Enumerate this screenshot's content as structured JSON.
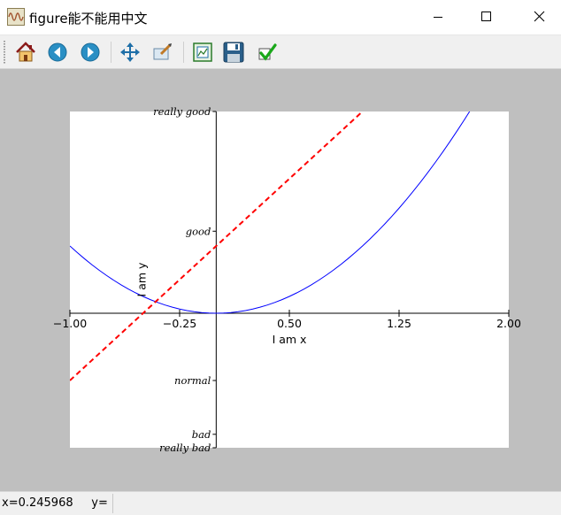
{
  "window": {
    "title": "figure能不能用中文"
  },
  "toolbar": {
    "buttons": [
      {
        "name": "home",
        "icon": "home-icon"
      },
      {
        "name": "back",
        "icon": "back-arrow-icon"
      },
      {
        "name": "forward",
        "icon": "forward-arrow-icon"
      },
      {
        "name": "pan",
        "icon": "move-arrows-icon"
      },
      {
        "name": "zoom",
        "icon": "zoom-rect-icon"
      },
      {
        "name": "subplots",
        "icon": "subplots-config-icon"
      },
      {
        "name": "save",
        "icon": "floppy-disk-icon"
      },
      {
        "name": "edit",
        "icon": "checkmark-edit-icon"
      }
    ]
  },
  "status": {
    "text": "x=0.245968     y="
  },
  "chart_data": {
    "type": "line",
    "xlabel": "I am x",
    "ylabel": "I am y",
    "xlim": [
      -1,
      2
    ],
    "ylim": [
      -2,
      3
    ],
    "xticks": [
      {
        "value": -1.0,
        "label": "−1.00"
      },
      {
        "value": -0.25,
        "label": "−0.25"
      },
      {
        "value": 0.5,
        "label": "0.50"
      },
      {
        "value": 1.25,
        "label": "1.25"
      },
      {
        "value": 2.0,
        "label": "2.00"
      }
    ],
    "yticks": [
      {
        "value": -2.0,
        "label": "really bad"
      },
      {
        "value": -1.8,
        "label": "bad"
      },
      {
        "value": -1.0,
        "label": "normal"
      },
      {
        "value": 1.22,
        "label": "good"
      },
      {
        "value": 3.0,
        "label": "really good"
      }
    ],
    "spines": "centered-at-origin",
    "series": [
      {
        "name": "",
        "color": "#0000ff",
        "style": "solid",
        "function": "y = x^2",
        "samples": 61
      },
      {
        "name": "",
        "color": "#ff0000",
        "style": "dashed",
        "function": "y = 2x + 1",
        "samples": 2
      }
    ]
  }
}
